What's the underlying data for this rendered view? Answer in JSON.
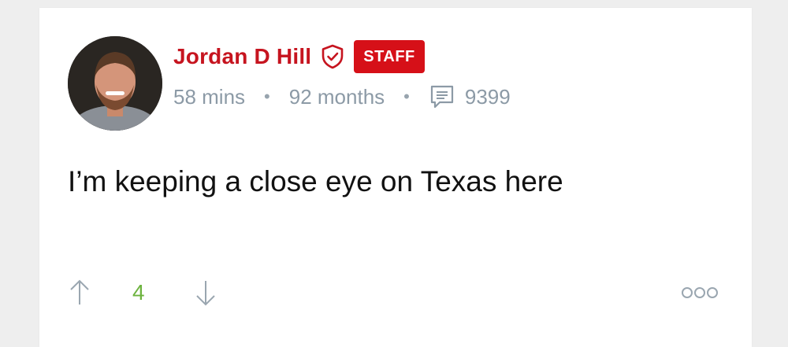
{
  "post": {
    "author": {
      "name": "Jordan D Hill",
      "badge": "STAFF",
      "avatar_icon": "avatar-photo"
    },
    "meta": {
      "time_ago": "58 mins",
      "separator": "•",
      "tenure": "92 months",
      "comment_count": "9399"
    },
    "body": "I’m keeping a close eye on Texas here",
    "votes": {
      "count": "4"
    },
    "icons": {
      "verified": "shield-check-icon",
      "comments": "comment-icon",
      "upvote": "arrow-up-icon",
      "downvote": "arrow-down-icon",
      "more": "more-options-icon"
    }
  },
  "colors": {
    "accent_red": "#c6141f",
    "badge_red": "#d61018",
    "meta_gray": "#8c9aa6",
    "vote_green": "#6db33f"
  }
}
